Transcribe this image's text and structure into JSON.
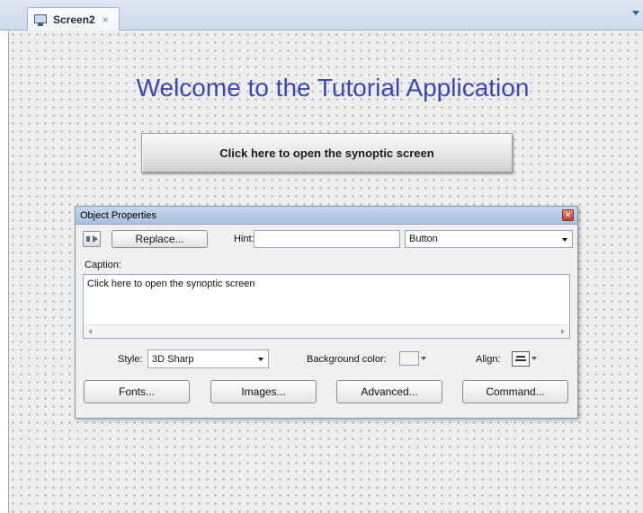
{
  "tab": {
    "label": "Screen2",
    "close_glyph": "×",
    "icon": "monitor-icon"
  },
  "canvas": {
    "welcome_text": "Welcome to the Tutorial Application",
    "main_button_label": "Click here to open the synoptic screen",
    "welcome_color": "#3b47b8"
  },
  "properties": {
    "title": "Object Properties",
    "replace_label": "Replace...",
    "hint_label": "Hint:",
    "hint_value": "",
    "type_value": "Button",
    "caption_label": "Caption:",
    "caption_value": "Click here to open the synoptic screen",
    "style_label": "Style:",
    "style_value": "3D Sharp",
    "background_color_label": "Background color:",
    "align_label": "Align:",
    "buttons": {
      "fonts": "Fonts...",
      "images": "Images...",
      "advanced": "Advanced...",
      "command": "Command..."
    }
  }
}
